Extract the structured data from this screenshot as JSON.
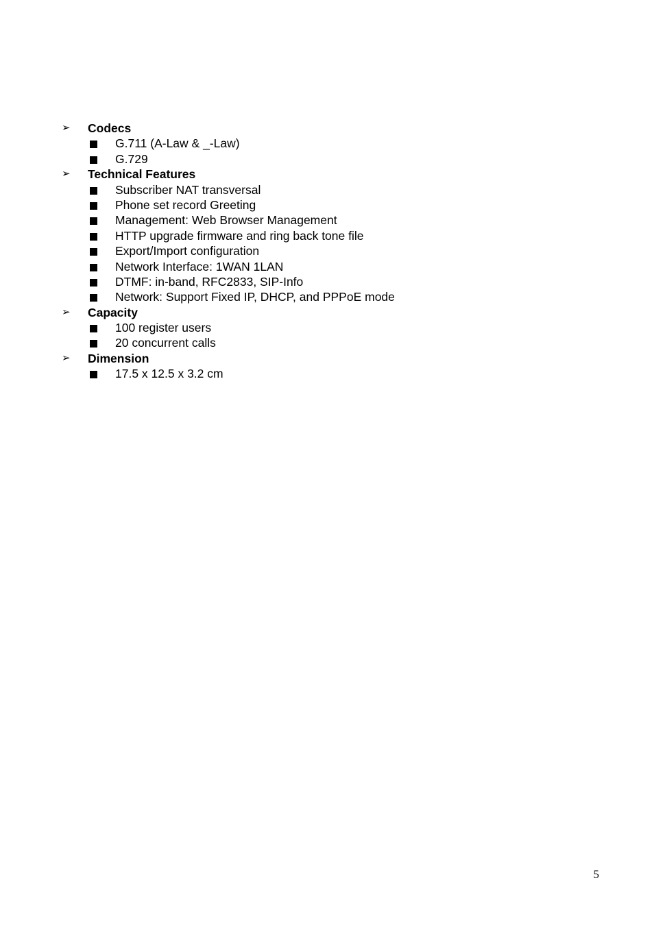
{
  "document": {
    "page_number": "5",
    "bullet_level1_glyph": "➢",
    "bullet_level2_glyph": "square-filled",
    "text_color": "#000000",
    "background_color": "#ffffff"
  },
  "sections": [
    {
      "heading": "Codecs",
      "items": [
        "G.711 (A-Law & _-Law)",
        "G.729"
      ]
    },
    {
      "heading": "Technical Features",
      "items": [
        "Subscriber NAT transversal",
        "Phone set record Greeting",
        "Management: Web Browser Management",
        "HTTP upgrade firmware and ring back tone file",
        "Export/Import configuration",
        "Network Interface: 1WAN 1LAN",
        "DTMF: in-band, RFC2833, SIP-Info",
        "Network: Support Fixed IP, DHCP, and PPPoE mode"
      ]
    },
    {
      "heading": "Capacity",
      "items": [
        "100 register users",
        "20 concurrent calls"
      ]
    },
    {
      "heading": "Dimension",
      "items": [
        "17.5 x 12.5 x 3.2 cm"
      ]
    }
  ]
}
